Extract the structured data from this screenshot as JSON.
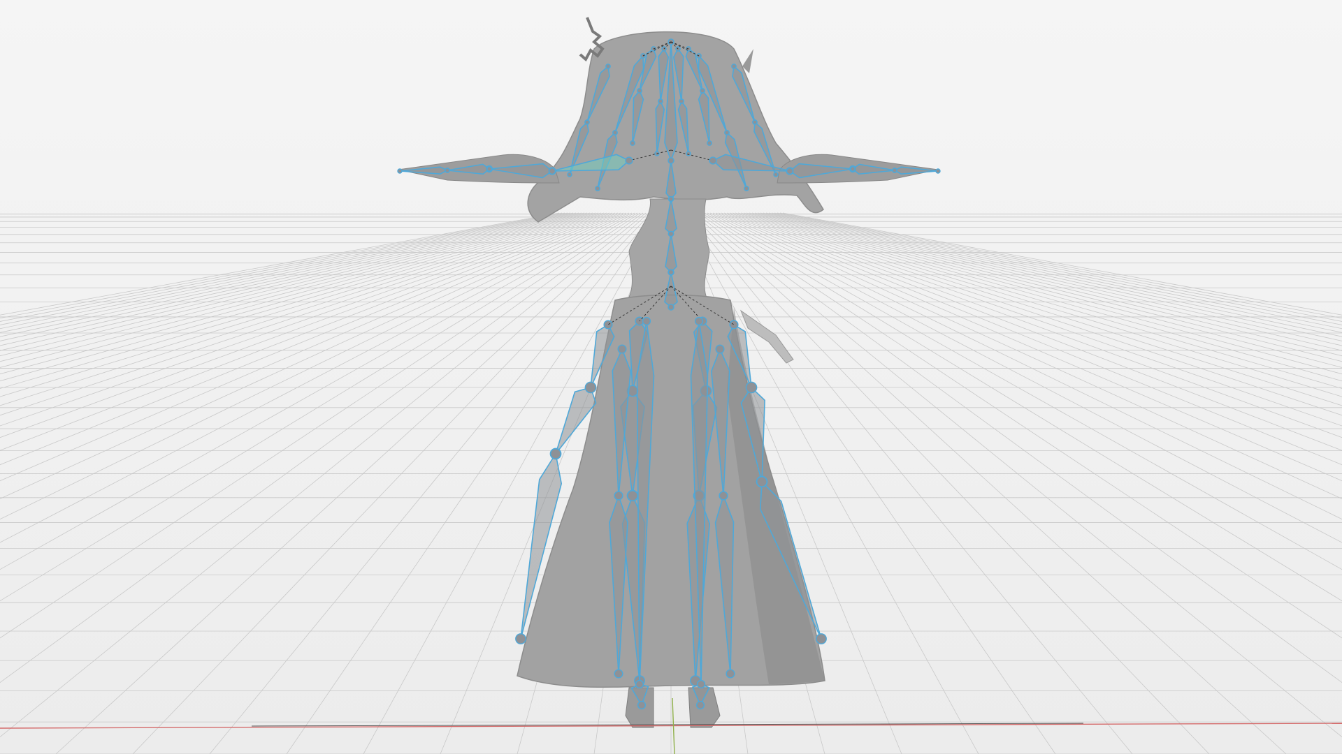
{
  "viewport": {
    "mode": "3d-viewport",
    "view": "back-orthographic",
    "shading": "solid",
    "colors": {
      "background": "#f3f3f3",
      "grid_line": "#c8c8c8",
      "mesh_fill": "#9a9a9a",
      "mesh_light": "#c2c2c2",
      "mesh_dark": "#7c7c7c",
      "bone_outline": "#4fa8d8",
      "bone_fill": "#8e9196",
      "bone_selected": "#6fd0c0",
      "x_axis": "#d46a6a",
      "y_axis": "#8fb04a",
      "relation_line": "#333333"
    },
    "objects": [
      {
        "name": "character-mesh",
        "icon": "mesh-icon"
      },
      {
        "name": "armature",
        "icon": "armature-icon"
      }
    ]
  }
}
